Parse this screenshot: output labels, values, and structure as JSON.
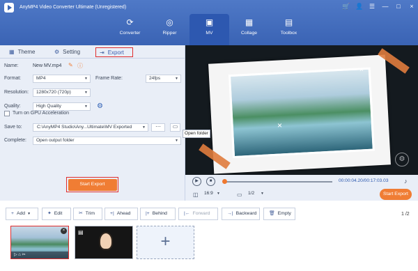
{
  "app": {
    "title": "AnyMP4 Video Converter Ultimate (Unregistered)",
    "window_controls": [
      "🛒",
      "👤",
      "☰",
      "—",
      "□",
      "×"
    ]
  },
  "nav": [
    {
      "label": "Converter",
      "icon": "converter-icon"
    },
    {
      "label": "Ripper",
      "icon": "ripper-icon"
    },
    {
      "label": "MV",
      "icon": "mv-icon",
      "active": true
    },
    {
      "label": "Collage",
      "icon": "collage-icon"
    },
    {
      "label": "Toolbox",
      "icon": "toolbox-icon"
    }
  ],
  "tabs": {
    "theme": "Theme",
    "setting": "Setting",
    "export": "Export"
  },
  "settings": {
    "name_label": "Name:",
    "name_value": "New MV.mp4",
    "format_label": "Format:",
    "format_value": "MP4",
    "frame_rate_label": "Frame Rate:",
    "frame_rate_value": "24fps",
    "resolution_label": "Resolution:",
    "resolution_value": "1280x720 (720p)",
    "quality_label": "Quality:",
    "quality_value": "High Quality",
    "gpu_label": "Turn on GPU Acceleration",
    "save_label": "Save to:",
    "save_value": "C:\\AnyMP4 Studio\\Any...Ultimate\\MV Exported",
    "complete_label": "Complete:",
    "complete_value": "Open output folder",
    "start_export": "Start Export"
  },
  "preview": {
    "tooltip": "Open folder",
    "time": "00:00:04.20/00:17:03.03",
    "ratio": "16:9",
    "page": "1/2",
    "start_export": "Start Export"
  },
  "toolbar": {
    "add": "Add",
    "edit": "Edit",
    "trim": "Trim",
    "ahead": "Ahead",
    "behind": "Behind",
    "forward": "Forward",
    "backward": "Backward",
    "empty": "Empty",
    "page_count": "1 /2"
  },
  "colors": {
    "accent": "#f07d34",
    "blue": "#3b66b8",
    "highlight": "#e02d2d"
  }
}
